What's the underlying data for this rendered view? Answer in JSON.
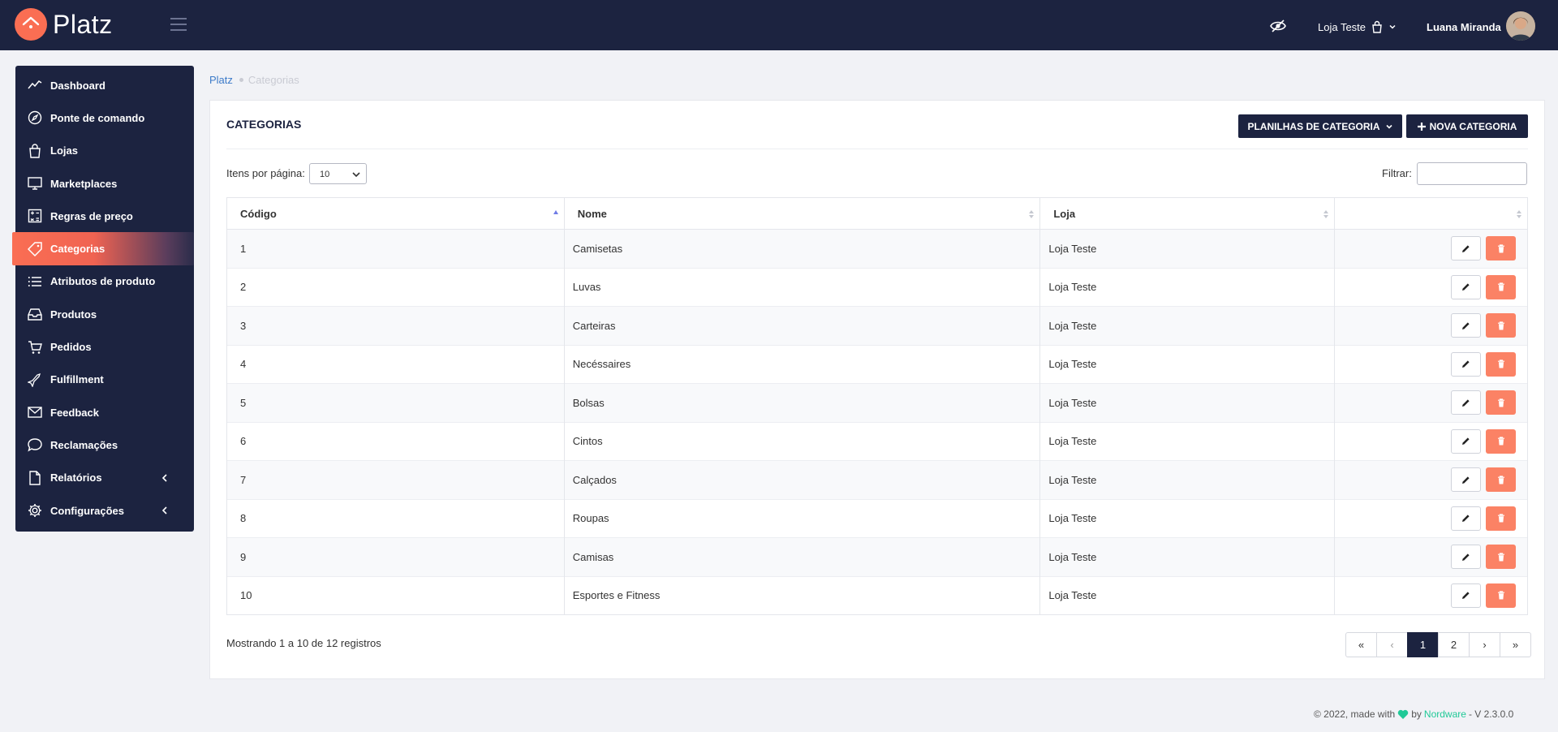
{
  "app": {
    "name": "Platz"
  },
  "topbar": {
    "store_label": "Loja Teste",
    "user_name": "Luana Miranda"
  },
  "sidebar": {
    "items": [
      {
        "label": "Dashboard",
        "icon": "chart-line-icon"
      },
      {
        "label": "Ponte de comando",
        "icon": "compass-icon"
      },
      {
        "label": "Lojas",
        "icon": "shopping-bag-icon"
      },
      {
        "label": "Marketplaces",
        "icon": "monitor-icon"
      },
      {
        "label": "Regras de preço",
        "icon": "calculator-icon"
      },
      {
        "label": "Categorias",
        "icon": "tag-icon",
        "active": true
      },
      {
        "label": "Atributos de produto",
        "icon": "list-icon"
      },
      {
        "label": "Produtos",
        "icon": "inbox-icon"
      },
      {
        "label": "Pedidos",
        "icon": "cart-icon"
      },
      {
        "label": "Fulfillment",
        "icon": "plane-icon"
      },
      {
        "label": "Feedback",
        "icon": "mail-icon"
      },
      {
        "label": "Reclamações",
        "icon": "chat-bubble-icon"
      },
      {
        "label": "Relatórios",
        "icon": "file-icon",
        "expandable": true
      },
      {
        "label": "Configurações",
        "icon": "gear-icon",
        "expandable": true
      }
    ]
  },
  "breadcrumb": {
    "home": "Platz",
    "current": "Categorias"
  },
  "page": {
    "title": "CATEGORIAS",
    "sheets_button": "PLANILHAS DE CATEGORIA",
    "new_button": "NOVA CATEGORIA",
    "items_per_page_label": "Itens por página:",
    "items_per_page_value": "10",
    "filter_label": "Filtrar:",
    "filter_value": ""
  },
  "table": {
    "columns": [
      "Código",
      "Nome",
      "Loja",
      ""
    ],
    "rows": [
      {
        "code": "1",
        "name": "Camisetas",
        "store": "Loja Teste"
      },
      {
        "code": "2",
        "name": "Luvas",
        "store": "Loja Teste"
      },
      {
        "code": "3",
        "name": "Carteiras",
        "store": "Loja Teste"
      },
      {
        "code": "4",
        "name": "Necéssaires",
        "store": "Loja Teste"
      },
      {
        "code": "5",
        "name": "Bolsas",
        "store": "Loja Teste"
      },
      {
        "code": "6",
        "name": "Cintos",
        "store": "Loja Teste"
      },
      {
        "code": "7",
        "name": "Calçados",
        "store": "Loja Teste"
      },
      {
        "code": "8",
        "name": "Roupas",
        "store": "Loja Teste"
      },
      {
        "code": "9",
        "name": "Camisas",
        "store": "Loja Teste"
      },
      {
        "code": "10",
        "name": "Esportes e Fitness",
        "store": "Loja Teste"
      }
    ]
  },
  "pagination": {
    "summary": "Mostrando 1 a 10 de 12 registros",
    "first": "«",
    "prev": "‹",
    "pages": [
      "1",
      "2"
    ],
    "current": "1",
    "next": "›",
    "last": "»"
  },
  "footer": {
    "prefix": "© 2022, made with",
    "by": "by",
    "brand": "Nordware",
    "version": "- V 2.3.0.0"
  },
  "colors": {
    "navy": "#1c2340",
    "accent": "#fa6e53",
    "delete": "#fb8265",
    "brand_green": "#20c997",
    "link": "#3d7bc9"
  }
}
